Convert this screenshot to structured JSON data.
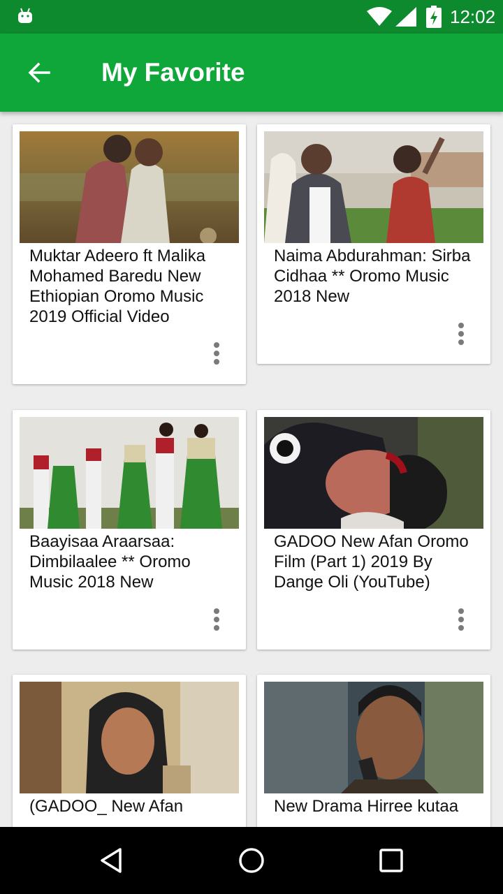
{
  "status_bar": {
    "time": "12:02",
    "icons": [
      "android-icon",
      "wifi-icon",
      "signal-icon",
      "battery-charging-icon"
    ]
  },
  "app_bar": {
    "title": "My Favorite",
    "back_icon": "arrow-left-icon"
  },
  "videos": [
    {
      "title": "Muktar Adeero ft Malika Mohamed Baredu New Ethiopian Oromo Music 2019 Official Video"
    },
    {
      "title": "Naima Abdurahman: Sirba Cidhaa ** Oromo Music 2018 New"
    },
    {
      "title": "Baayisaa Araarsaa: Dimbilaalee ** Oromo Music 2018 New"
    },
    {
      "title": "GADOO  New Afan Oromo Film (Part 1) 2019 By Dange Oli   (YouTube)"
    },
    {
      "title": "(GADOO_ New Afan"
    },
    {
      "title": "New Drama Hirree kutaa"
    }
  ],
  "nav_bar": {
    "icons": [
      "back-triangle-icon",
      "home-circle-icon",
      "recents-square-icon"
    ]
  },
  "colors": {
    "status_bar": "#0e8a2e",
    "app_bar": "#0fa73a",
    "background": "#ededed"
  }
}
